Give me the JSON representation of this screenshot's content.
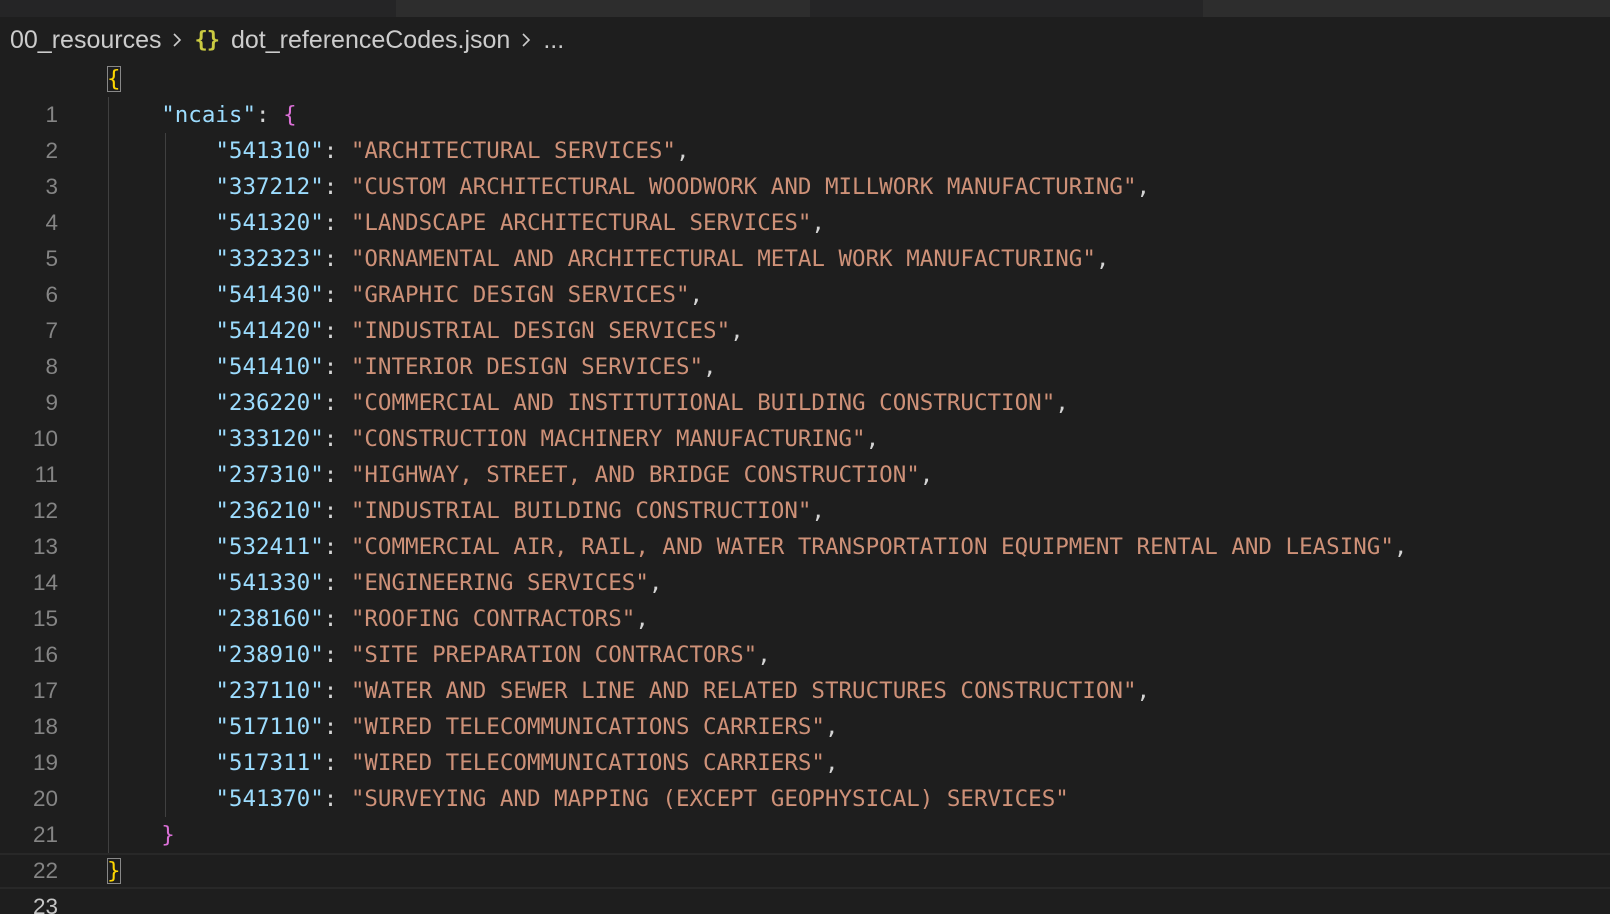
{
  "breadcrumb": {
    "folder": "00_resources",
    "file_icon": "json-braces-icon",
    "file_icon_glyph": "{}",
    "file": "dot_referenceCodes.json",
    "more": "..."
  },
  "editor": {
    "current_line": "23",
    "lines": [
      {
        "num": "1"
      },
      {
        "num": "2",
        "key": "\"ncais\""
      },
      {
        "num": "3",
        "key": "\"541310\"",
        "value": "\"ARCHITECTURAL SERVICES\""
      },
      {
        "num": "4",
        "key": "\"337212\"",
        "value": "\"CUSTOM ARCHITECTURAL WOODWORK AND MILLWORK MANUFACTURING\""
      },
      {
        "num": "5",
        "key": "\"541320\"",
        "value": "\"LANDSCAPE ARCHITECTURAL SERVICES\""
      },
      {
        "num": "6",
        "key": "\"332323\"",
        "value": "\"ORNAMENTAL AND ARCHITECTURAL METAL WORK MANUFACTURING\""
      },
      {
        "num": "7",
        "key": "\"541430\"",
        "value": "\"GRAPHIC DESIGN SERVICES\""
      },
      {
        "num": "8",
        "key": "\"541420\"",
        "value": "\"INDUSTRIAL DESIGN SERVICES\""
      },
      {
        "num": "9",
        "key": "\"541410\"",
        "value": "\"INTERIOR DESIGN SERVICES\""
      },
      {
        "num": "10",
        "key": "\"236220\"",
        "value": "\"COMMERCIAL AND INSTITUTIONAL BUILDING CONSTRUCTION\""
      },
      {
        "num": "11",
        "key": "\"333120\"",
        "value": "\"CONSTRUCTION MACHINERY MANUFACTURING\""
      },
      {
        "num": "12",
        "key": "\"237310\"",
        "value": "\"HIGHWAY, STREET, AND BRIDGE CONSTRUCTION\""
      },
      {
        "num": "13",
        "key": "\"236210\"",
        "value": "\"INDUSTRIAL BUILDING CONSTRUCTION\""
      },
      {
        "num": "14",
        "key": "\"532411\"",
        "value": "\"COMMERCIAL AIR, RAIL, AND WATER TRANSPORTATION EQUIPMENT RENTAL AND LEASING\""
      },
      {
        "num": "15",
        "key": "\"541330\"",
        "value": "\"ENGINEERING SERVICES\""
      },
      {
        "num": "16",
        "key": "\"238160\"",
        "value": "\"ROOFING CONTRACTORS\""
      },
      {
        "num": "17",
        "key": "\"238910\"",
        "value": "\"SITE PREPARATION CONTRACTORS\""
      },
      {
        "num": "18",
        "key": "\"237110\"",
        "value": "\"WATER AND SEWER LINE AND RELATED STRUCTURES CONSTRUCTION\""
      },
      {
        "num": "19",
        "key": "\"517110\"",
        "value": "\"WIRED TELECOMMUNICATIONS CARRIERS\""
      },
      {
        "num": "20",
        "key": "\"517311\"",
        "value": "\"WIRED TELECOMMUNICATIONS CARRIERS\""
      },
      {
        "num": "21",
        "key": "\"541370\"",
        "value": "\"SURVEYING AND MAPPING (EXCEPT GEOPHYSICAL) SERVICES\""
      },
      {
        "num": "22"
      },
      {
        "num": "23"
      }
    ]
  },
  "colors": {
    "background": "#1e1e1e",
    "key": "#9cdcfe",
    "string": "#ce9178",
    "bracket_level1": "#ffd700",
    "bracket_level2": "#da70d6",
    "line_number": "#858585"
  }
}
